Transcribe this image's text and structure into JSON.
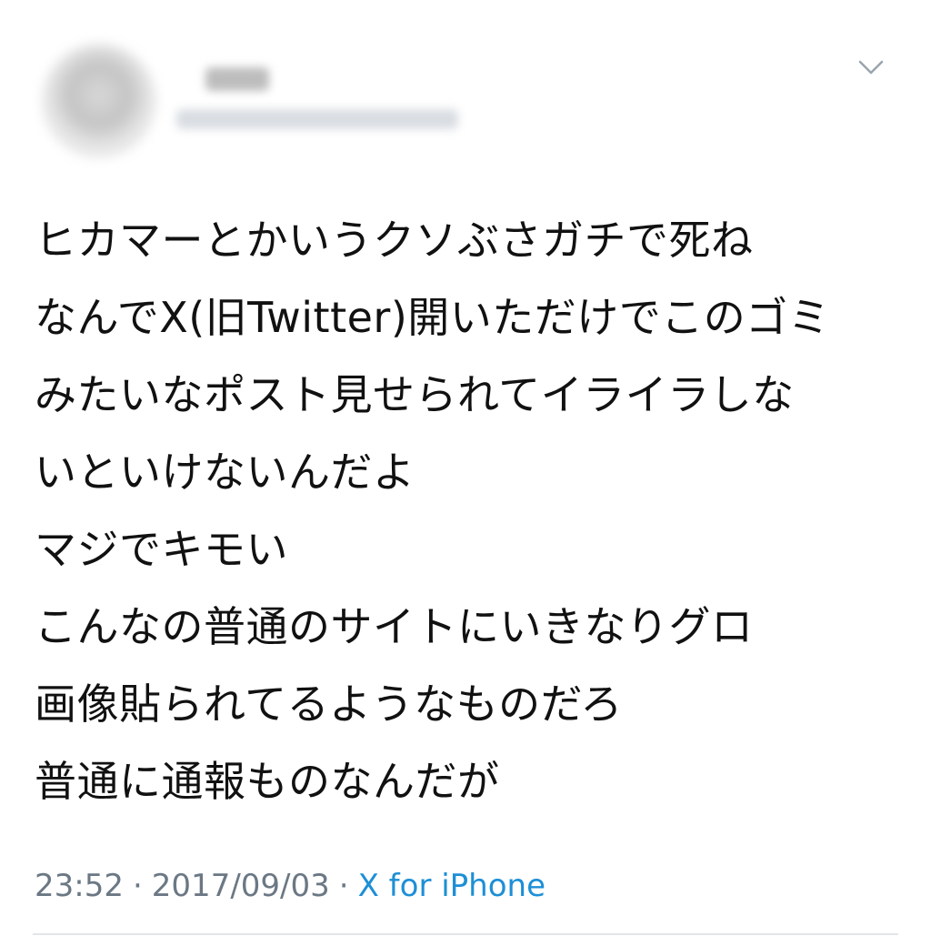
{
  "tweet": {
    "author": {
      "name": "",
      "handle": ""
    },
    "lines": [
      "ヒカマーとかいうクソぶさガチで死ね",
      "なんでX(旧Twitter)開いただけでこのゴミ",
      "みたいなポスト見せられてイライラしな",
      "いといけないんだよ",
      "マジでキモい",
      "こんなの普通のサイトにいきなりグロ",
      "画像貼られてるようなものだろ",
      "普通に通報ものなんだが"
    ],
    "time": "23:52",
    "date": "2017/09/03",
    "source": "X for iPhone",
    "separator": "·",
    "menu_icon": "chevron-down-icon"
  },
  "colors": {
    "text": "#111111",
    "meta": "#6b7884",
    "link": "#1d8fd6",
    "divider": "#e1e6ea"
  }
}
